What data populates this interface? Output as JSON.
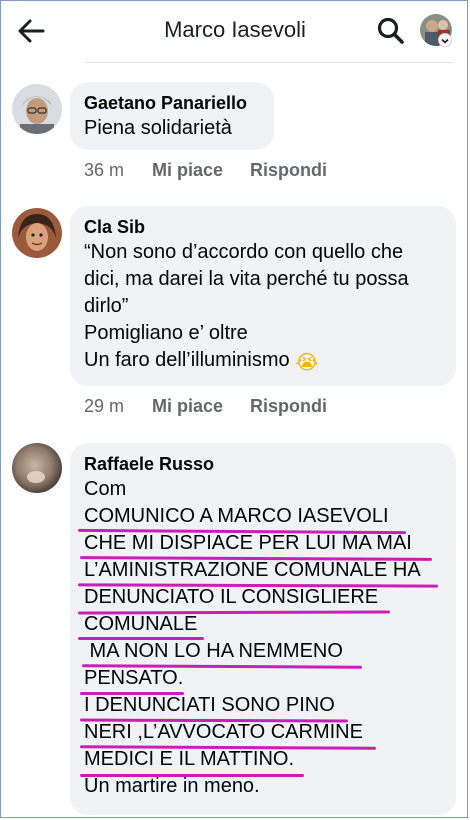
{
  "header": {
    "title": "Marco Iasevoli"
  },
  "comments": [
    {
      "author": "Gaetano Panariello",
      "lines": [
        "Piena solidarietà"
      ],
      "time": "36 m",
      "like_label": "Mi piace",
      "reply_label": "Rispondi"
    },
    {
      "author": "Cla Sib",
      "lines": [
        "“Non sono d’accordo con quello che",
        "dici, ma darei la vita perché tu possa",
        "dirlo”",
        "Pomigliano e’ oltre",
        "Un faro dell’illuminismo"
      ],
      "emoji": "😭",
      "time": "29 m",
      "like_label": "Mi piace",
      "reply_label": "Rispondi"
    },
    {
      "author": "Raffaele Russo",
      "lines": [
        "Com",
        "COMUNICO A MARCO IASEVOLI",
        "CHE MI DISPIACE PER LUI MA MAI",
        "L’AMINISTRAZIONE COMUNALE HA",
        "DENUNCIATO IL CONSIGLIERE",
        "COMUNALE",
        " MA NON LO HA NEMMENO",
        "PENSATO.",
        "I DENUNCIATI SONO PINO",
        "NERI ,L’AVVOCATO CARMINE",
        "MEDICI E IL MATTINO.",
        "Un martire in meno."
      ]
    }
  ],
  "colors": {
    "bubble": "#f0f2f5",
    "meta_text": "#65676b",
    "underline": "#c81fb4"
  },
  "icons": [
    "back-arrow-icon",
    "search-icon",
    "avatar-chevron-icon",
    "crying-face-emoji-icon"
  ]
}
